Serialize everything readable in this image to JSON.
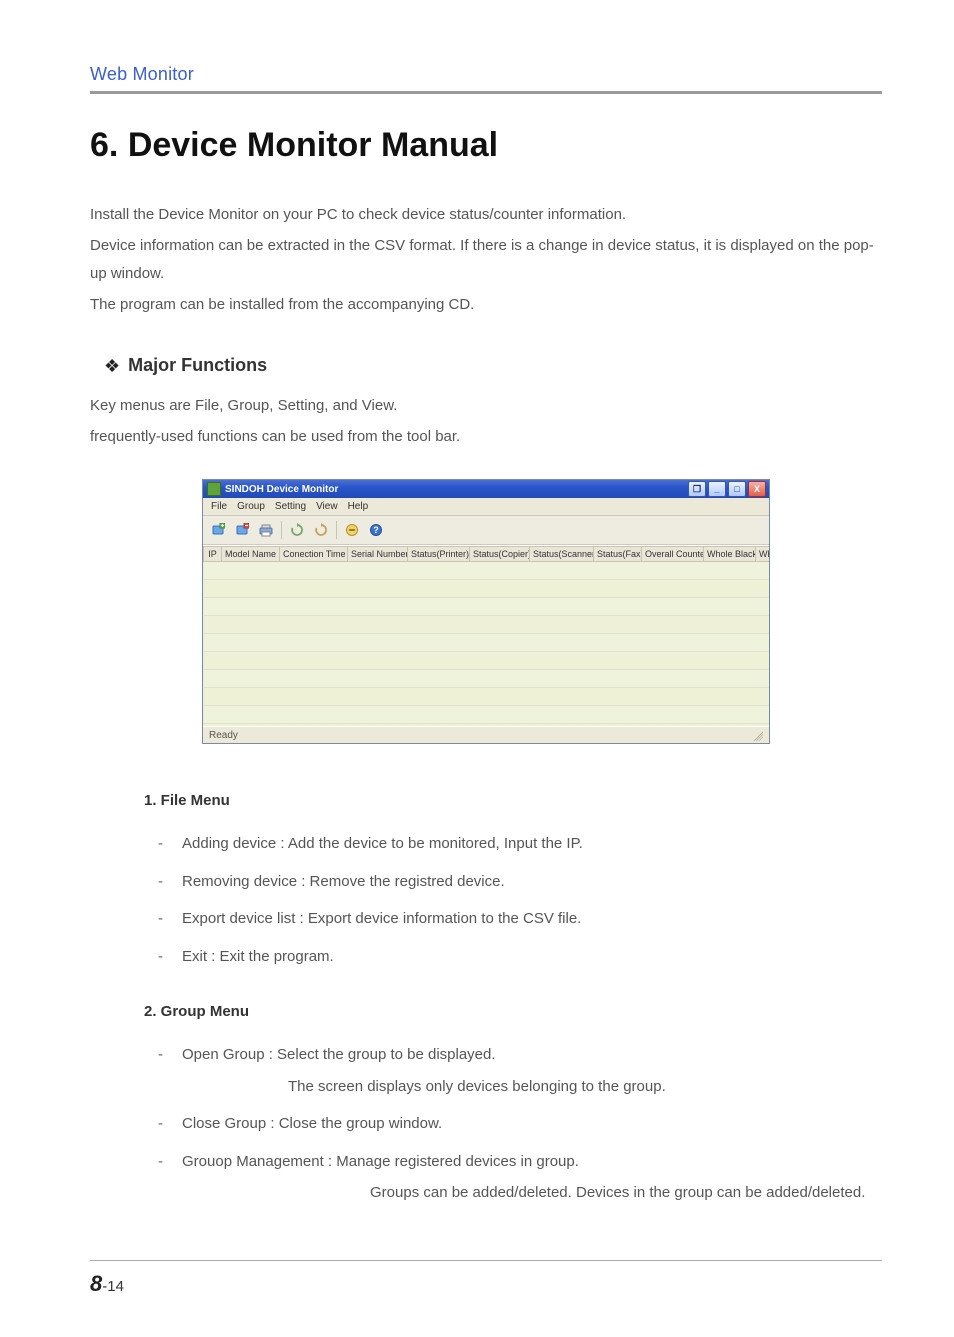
{
  "header": {
    "breadcrumb": "Web Monitor"
  },
  "chapter": {
    "number": "6.",
    "title": "Device Monitor Manual"
  },
  "intro": {
    "p1": "Install the Device Monitor on your PC to check device status/counter information.",
    "p2": "Device information can be extracted in the CSV format. If there is a change in device status, it is displayed on the pop-up window.",
    "p3": "The program can be installed from the accompanying CD."
  },
  "major": {
    "heading": "Major Functions",
    "p1": "Key menus are File, Group, Setting, and View.",
    "p2": "frequently-used functions can be used from the tool bar."
  },
  "app": {
    "title": "SINDOH Device Monitor",
    "menus": [
      "File",
      "Group",
      "Setting",
      "View",
      "Help"
    ],
    "columns": [
      "IP",
      "Model Name",
      "Conection Time",
      "Serial Number",
      "Status(Printer)",
      "Status(Copier)",
      "Status(Scanner)",
      "Status(Fax)",
      "Overall Counter",
      "Whole Black",
      "Whole Color"
    ],
    "status": "Ready",
    "window_buttons": {
      "min": "_",
      "max": "□",
      "restore": "❐",
      "close": "X"
    }
  },
  "menu1": {
    "heading": "1. File Menu",
    "items": [
      "Adding device : Add the device to be monitored, Input the IP.",
      "Removing device : Remove the registred device.",
      "Export device list : Export device information to the CSV file.",
      "Exit : Exit the program."
    ]
  },
  "menu2": {
    "heading": "2. Group Menu",
    "items": {
      "open": {
        "line": "Open Group : Select the group to be displayed.",
        "cont": "The screen displays only devices belonging to the group."
      },
      "close": {
        "line": "Close Group : Close the group window."
      },
      "mgmt": {
        "line": "Grouop Management : Manage registered devices in group.",
        "cont": "Groups can be added/deleted. Devices in the group can be added/deleted."
      }
    }
  },
  "footer": {
    "chapter": "8",
    "page": "-14"
  }
}
